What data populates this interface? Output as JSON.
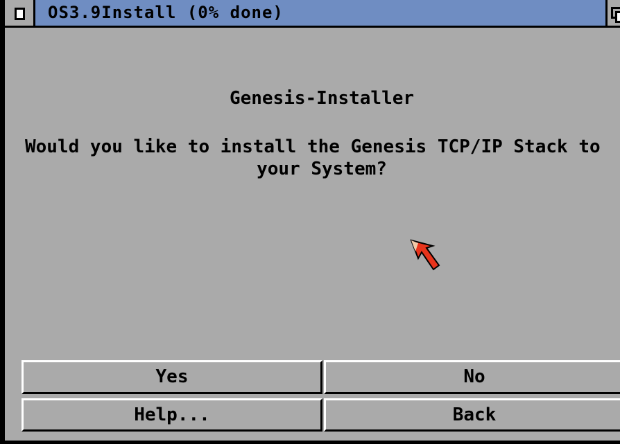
{
  "window": {
    "title": "OS3.9Install (0% done)"
  },
  "dialog": {
    "heading": "Genesis-Installer",
    "question_line1": "Would you like to install the Genesis TCP/IP Stack to",
    "question_line2": "your System?"
  },
  "buttons": {
    "yes": "Yes",
    "no": "No",
    "help": "Help...",
    "back": "Back"
  },
  "icons": {
    "close": "close-gadget-icon",
    "depth": "depth-gadget-icon",
    "pointer": "mouse-pointer-icon"
  },
  "colors": {
    "titlebar": "#6f8dc2",
    "window_bg": "#aaaaaa",
    "pointer": "#e8341c"
  }
}
